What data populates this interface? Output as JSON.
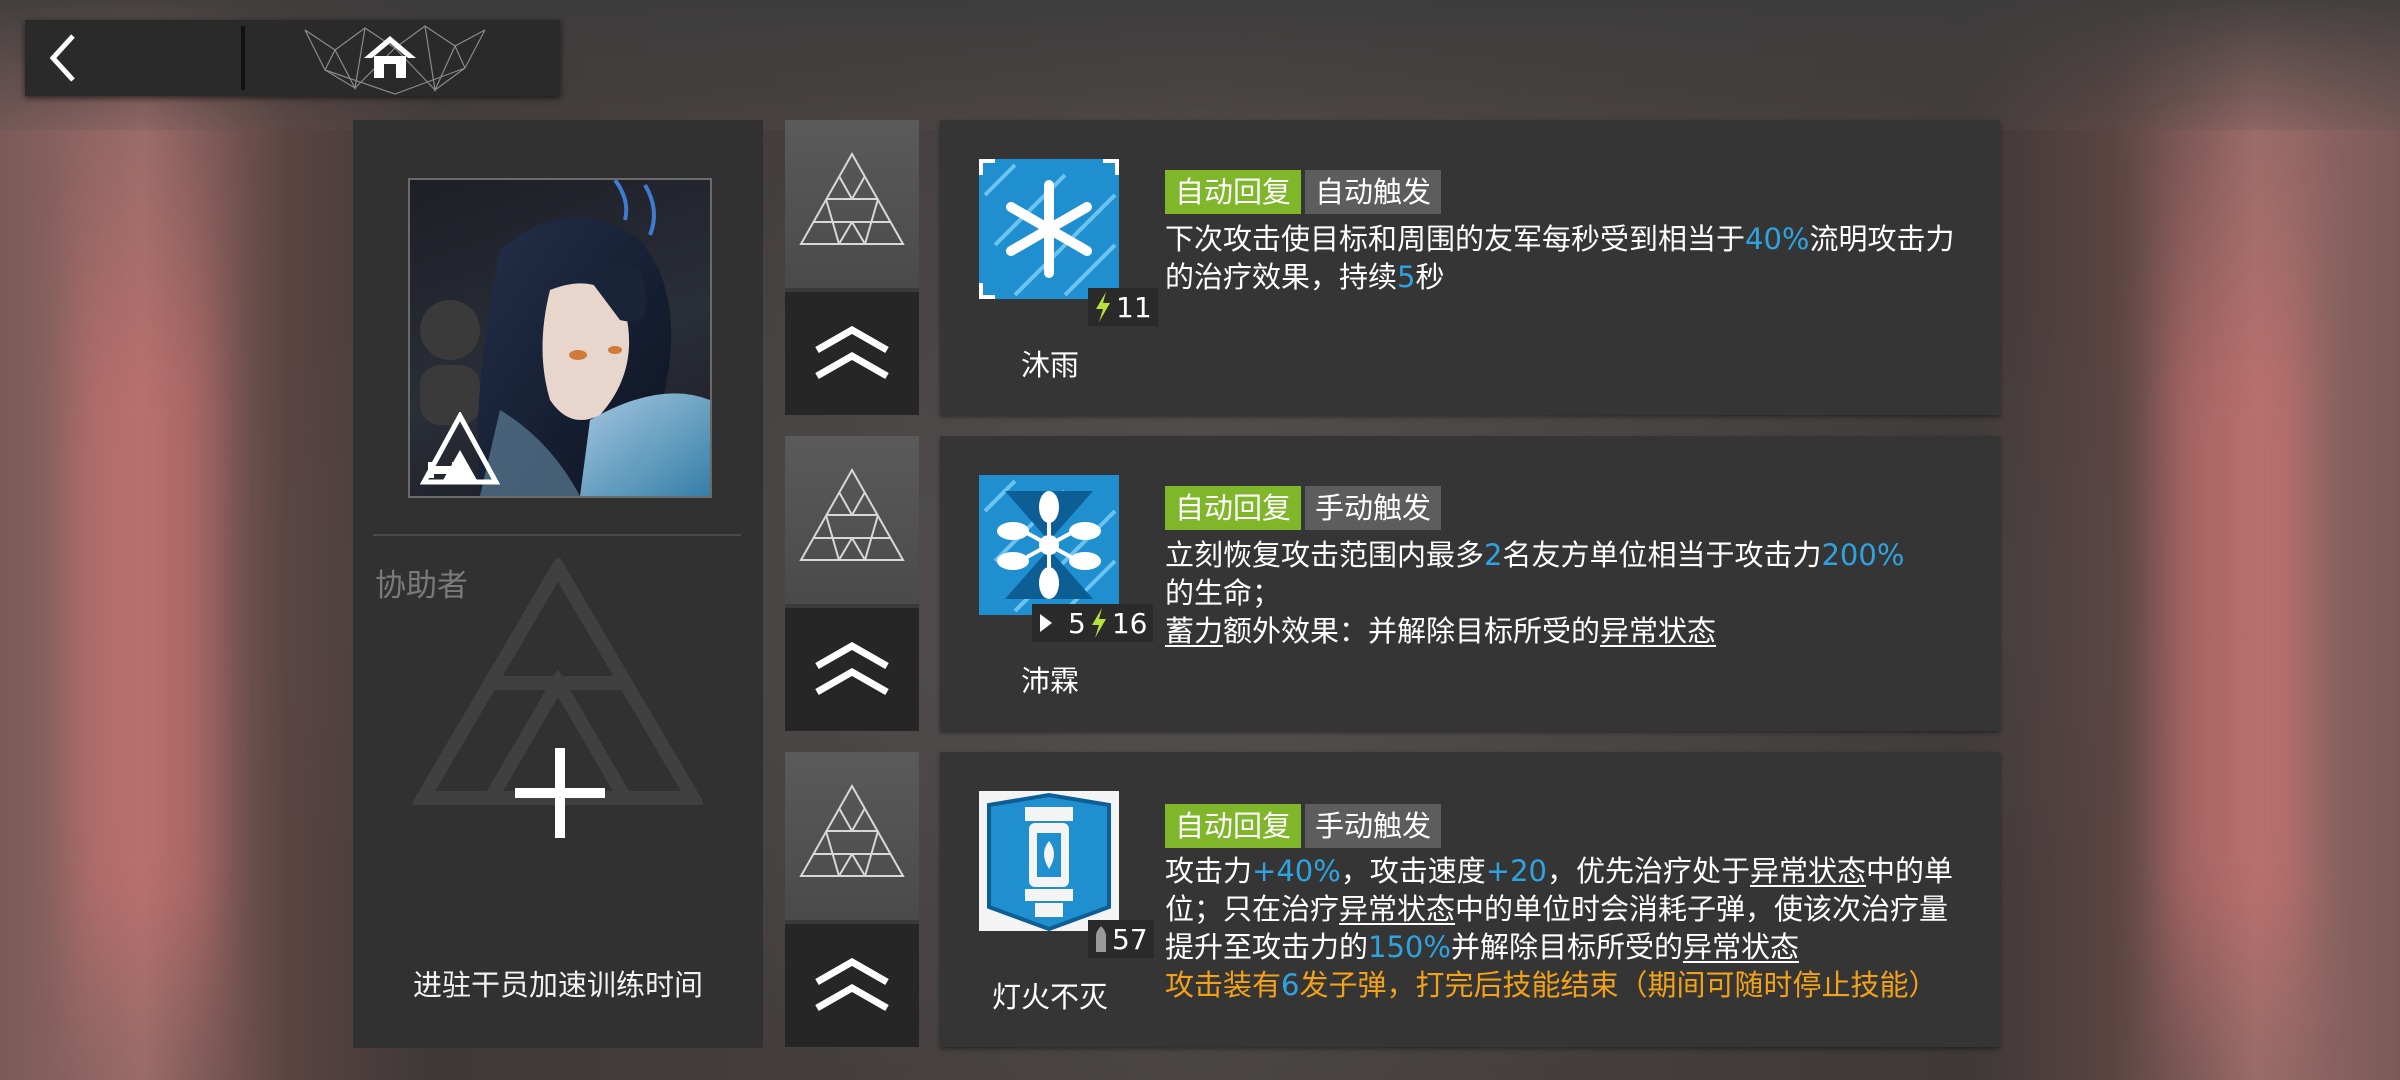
{
  "nav": {
    "back_icon": "chevron-left-icon",
    "home_icon": "home-icon"
  },
  "operator": {
    "portrait_alt": "operator-portrait",
    "class_icon": "medic-class-icon"
  },
  "assistant": {
    "label": "协助者",
    "add_icon": "plus-icon",
    "desc": "进驻干员加速训练时间"
  },
  "skills": [
    {
      "name": "沐雨",
      "sp": "11",
      "tags": [
        "自动回复",
        "自动触发"
      ],
      "desc_parts": [
        "下次攻击使目标和周围的友军每秒受到相当于",
        "40%",
        "流明攻击力的治疗效果，持续",
        "5",
        "秒"
      ]
    },
    {
      "name": "沛霖",
      "init_sp": "5",
      "sp": "16",
      "tags": [
        "自动回复",
        "手动触发"
      ],
      "desc_parts": [
        "立刻恢复攻击范围内最多",
        "2",
        "名友方单位相当于攻击力",
        "200%",
        "的生命；"
      ],
      "charge_label": "蓄力",
      "charge_text": "额外效果：并解除目标所受的",
      "charge_status": "异常状态"
    },
    {
      "name": "灯火不灭",
      "sp": "57",
      "tags": [
        "自动回复",
        "手动触发"
      ],
      "desc_parts": [
        "攻击力",
        "+40%",
        "，攻击速度",
        "+20",
        "，优先治疗处于",
        "异常状态",
        "中的单位；只在治疗",
        "异常状态",
        "中的单位时会消耗子弹，使该次治疗量提升至攻击力的",
        "150%",
        "并解除目标所受的",
        "异常状态"
      ],
      "ammo_parts": [
        "攻击装有",
        "6",
        "发子弹，打完后技能结束（期间可随时停止技能）"
      ]
    }
  ],
  "colors": {
    "accent_blue": "#2fa3e0",
    "tag_green": "#7fb62a",
    "tag_gray": "#5d5d5d",
    "ammo_orange": "#f1a219",
    "sp_yellow": "#b7e23a"
  }
}
